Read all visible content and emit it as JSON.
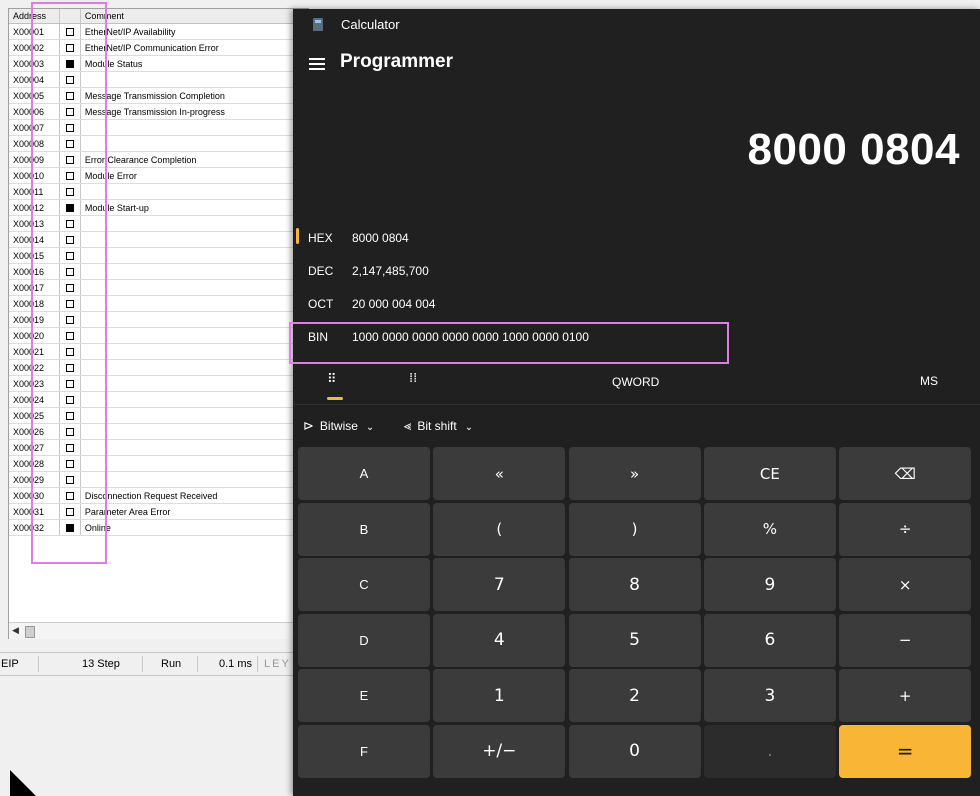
{
  "io_monitor": {
    "headers": {
      "address": "Address",
      "state": "",
      "comment": "Comment"
    },
    "rows": [
      {
        "address": "X00001",
        "state": false,
        "comment": "EtherNet/IP Availability"
      },
      {
        "address": "X00002",
        "state": false,
        "comment": "EtherNet/IP Communication Error"
      },
      {
        "address": "X00003",
        "state": true,
        "comment": "Module Status"
      },
      {
        "address": "X00004",
        "state": false,
        "comment": ""
      },
      {
        "address": "X00005",
        "state": false,
        "comment": "Message Transmission Completion"
      },
      {
        "address": "X00006",
        "state": false,
        "comment": "Message Transmission In-progress"
      },
      {
        "address": "X00007",
        "state": false,
        "comment": ""
      },
      {
        "address": "X00008",
        "state": false,
        "comment": ""
      },
      {
        "address": "X00009",
        "state": false,
        "comment": "Error Clearance Completion"
      },
      {
        "address": "X00010",
        "state": false,
        "comment": "Module Error"
      },
      {
        "address": "X00011",
        "state": false,
        "comment": ""
      },
      {
        "address": "X00012",
        "state": true,
        "comment": "Module Start-up"
      },
      {
        "address": "X00013",
        "state": false,
        "comment": ""
      },
      {
        "address": "X00014",
        "state": false,
        "comment": ""
      },
      {
        "address": "X00015",
        "state": false,
        "comment": ""
      },
      {
        "address": "X00016",
        "state": false,
        "comment": ""
      },
      {
        "address": "X00017",
        "state": false,
        "comment": ""
      },
      {
        "address": "X00018",
        "state": false,
        "comment": ""
      },
      {
        "address": "X00019",
        "state": false,
        "comment": ""
      },
      {
        "address": "X00020",
        "state": false,
        "comment": ""
      },
      {
        "address": "X00021",
        "state": false,
        "comment": ""
      },
      {
        "address": "X00022",
        "state": false,
        "comment": ""
      },
      {
        "address": "X00023",
        "state": false,
        "comment": ""
      },
      {
        "address": "X00024",
        "state": false,
        "comment": ""
      },
      {
        "address": "X00025",
        "state": false,
        "comment": ""
      },
      {
        "address": "X00026",
        "state": false,
        "comment": ""
      },
      {
        "address": "X00027",
        "state": false,
        "comment": ""
      },
      {
        "address": "X00028",
        "state": false,
        "comment": ""
      },
      {
        "address": "X00029",
        "state": false,
        "comment": ""
      },
      {
        "address": "X00030",
        "state": false,
        "comment": "Disconnection Request Received"
      },
      {
        "address": "X00031",
        "state": false,
        "comment": "Parameter Area Error"
      },
      {
        "address": "X00032",
        "state": true,
        "comment": "Online"
      }
    ],
    "status_bar": {
      "mode": "EIP",
      "steps": "13 Step",
      "run": "Run",
      "scan": "0.1 ms",
      "brand": "LEY"
    }
  },
  "calculator": {
    "app_title": "Calculator",
    "mode": "Programmer",
    "display": "8000 0804",
    "radix": [
      {
        "label": "HEX",
        "value": "8000 0804",
        "selected": true
      },
      {
        "label": "DEC",
        "value": "2,147,485,700",
        "selected": false
      },
      {
        "label": "OCT",
        "value": "20 000 004 004",
        "selected": false
      },
      {
        "label": "BIN",
        "value": "1000 0000 0000 0000 0000 1000 0000 0100",
        "selected": false
      }
    ],
    "word_size": "QWORD",
    "memory": "MS",
    "bitwise": "Bitwise",
    "bitshift": "Bit shift",
    "keys": [
      [
        "A",
        "«",
        "»",
        "CE",
        "⌫"
      ],
      [
        "B",
        "(",
        ")",
        "%",
        "÷"
      ],
      [
        "C",
        "7",
        "8",
        "9",
        "×"
      ],
      [
        "D",
        "4",
        "5",
        "6",
        "−"
      ],
      [
        "E",
        "1",
        "2",
        "3",
        "+"
      ],
      [
        "F",
        "+/−",
        "0",
        ".",
        "="
      ]
    ],
    "accent": "#f3b73d"
  }
}
